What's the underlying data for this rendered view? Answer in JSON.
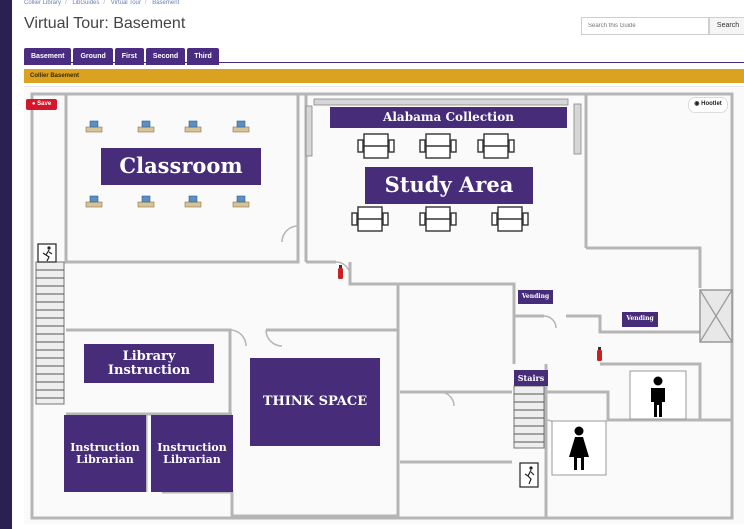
{
  "breadcrumb": [
    "Collier Library",
    "LibGuides",
    "Virtual Tour",
    "Basement"
  ],
  "page_title": "Virtual Tour: Basement",
  "search": {
    "placeholder": "Search this Guide",
    "button_label": "Search"
  },
  "tabs": [
    {
      "label": "Basement",
      "active": true
    },
    {
      "label": "Ground",
      "active": false
    },
    {
      "label": "First",
      "active": false
    },
    {
      "label": "Second",
      "active": false
    },
    {
      "label": "Third",
      "active": false
    }
  ],
  "panel_title": "Collier Basement",
  "save_label": "Save",
  "hootlet_label": "Hootlet",
  "rooms": {
    "alabama_collection": "Alabama Collection",
    "classroom": "Classroom",
    "study_area": "Study Area",
    "vending_1": "Vending",
    "vending_2": "Vending",
    "library_instruction": "Library Instruction",
    "think_space": "THINK SPACE",
    "instruction_librarian_1": "Instruction Librarian",
    "instruction_librarian_2": "Instruction Librarian",
    "stairs": "Stairs"
  },
  "icons": [
    "computer-icon",
    "table-icon",
    "fire-extinguisher-icon",
    "emergency-exit-icon",
    "elevator-icon",
    "men-restroom-icon",
    "women-restroom-icon"
  ],
  "colors": {
    "label_purple": "#472c7a",
    "tab_purple": "#4a2c83",
    "panel_gold": "#dba120",
    "wall": "#b5b5b5"
  }
}
